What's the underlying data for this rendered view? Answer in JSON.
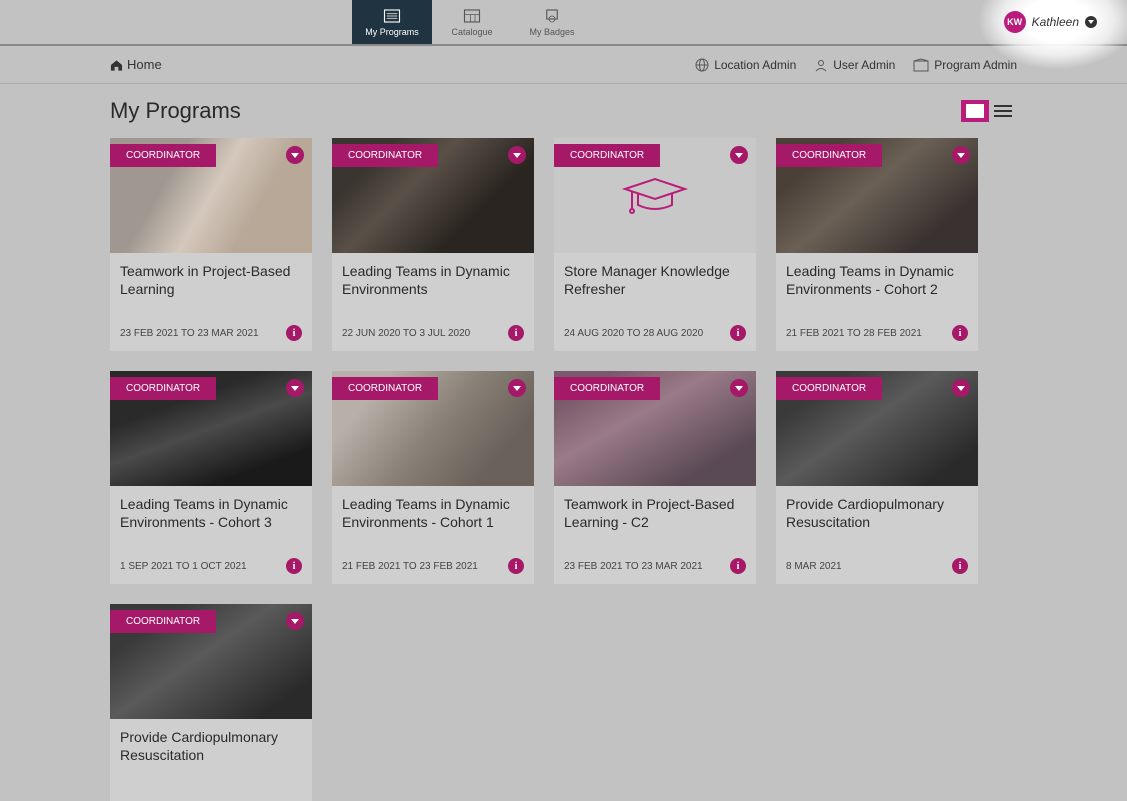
{
  "user": {
    "initials": "KW",
    "name": "Kathleen"
  },
  "nav": {
    "my_programs": "My Programs",
    "catalogue": "Catalogue",
    "my_badges": "My Badges"
  },
  "subnav": {
    "home": "Home",
    "location_admin": "Location Admin",
    "user_admin": "User Admin",
    "program_admin": "Program Admin"
  },
  "page_title": "My Programs",
  "role_label": "COORDINATOR",
  "cards": [
    {
      "title": "Teamwork in Project-Based Learning",
      "dates": "23 FEB 2021 TO 23 MAR 2021"
    },
    {
      "title": "Leading Teams in Dynamic Environments",
      "dates": "22 JUN 2020 TO 3 JUL 2020"
    },
    {
      "title": "Store Manager Knowledge Refresher",
      "dates": "24 AUG 2020 TO 28 AUG 2020"
    },
    {
      "title": "Leading Teams in Dynamic Environments - Cohort 2",
      "dates": "21 FEB 2021 TO 28 FEB 2021"
    },
    {
      "title": "Leading Teams in Dynamic Environments - Cohort 3",
      "dates": "1 SEP 2021 TO 1 OCT 2021"
    },
    {
      "title": "Leading Teams in Dynamic Environments - Cohort 1",
      "dates": "21 FEB 2021 TO 23 FEB 2021"
    },
    {
      "title": "Teamwork in Project-Based Learning - C2",
      "dates": "23 FEB 2021 TO 23 MAR 2021"
    },
    {
      "title": "Provide Cardiopulmonary Resuscitation",
      "dates": "8 MAR 2021"
    },
    {
      "title": "Provide Cardiopulmonary Resuscitation",
      "dates": ""
    }
  ]
}
